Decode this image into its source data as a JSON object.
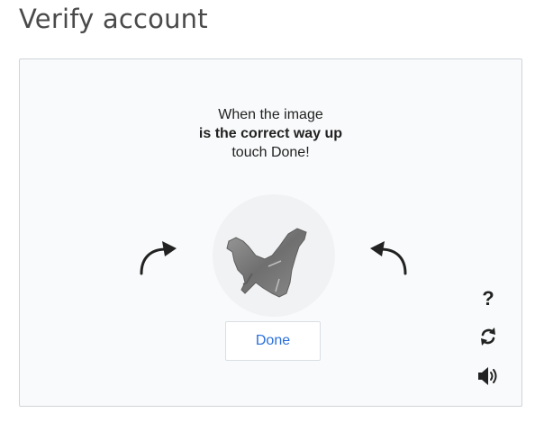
{
  "header": {
    "title": "Verify account"
  },
  "challenge": {
    "line1": "When the image",
    "line2": "is the correct way up",
    "line3": "touch Done!",
    "done_label": "Done"
  },
  "tools": {
    "help_label": "?",
    "help_icon": "question-mark-icon",
    "refresh_icon": "refresh-icon",
    "audio_icon": "speaker-icon"
  },
  "colors": {
    "panel_bg": "#f9fafb",
    "panel_border": "#cfd4d8",
    "done_text": "#2a6fdb",
    "title_text": "#4a4a4a"
  }
}
